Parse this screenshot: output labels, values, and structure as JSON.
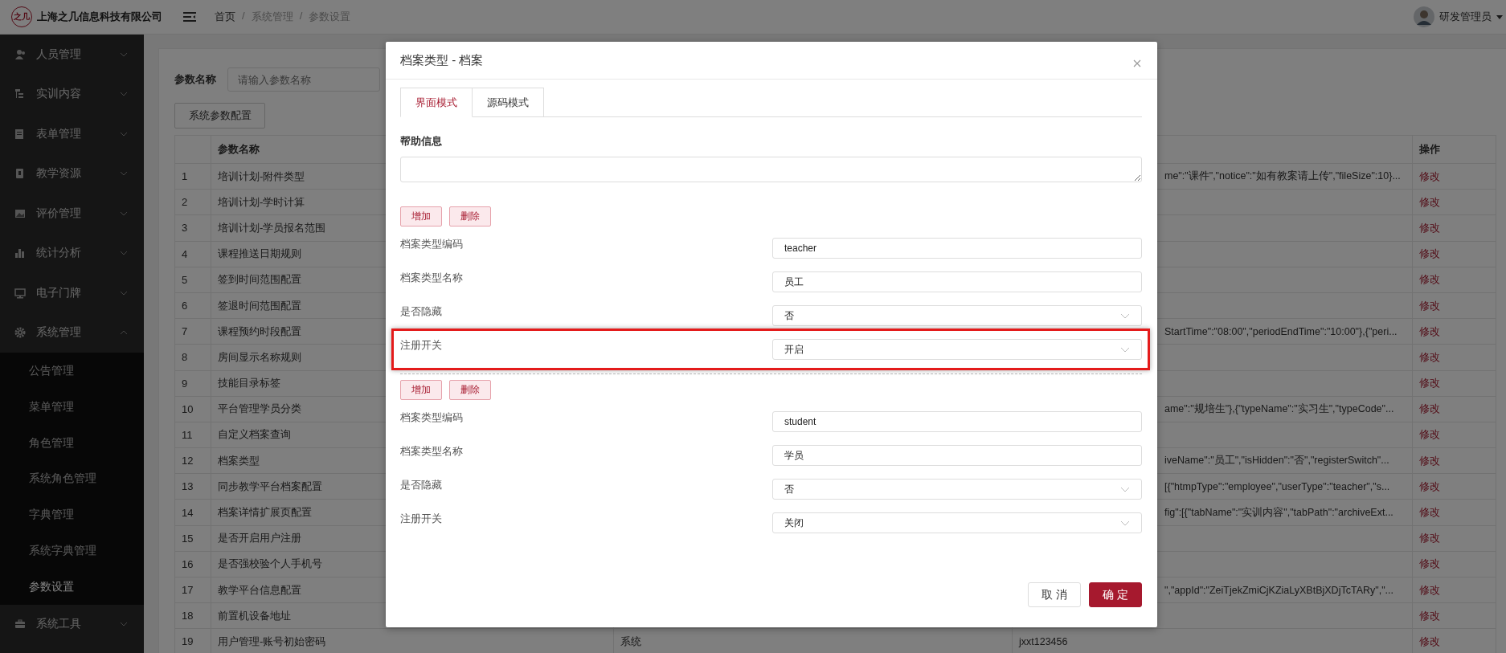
{
  "header": {
    "logo_text": "之几",
    "company": "上海之几信息科技有限公司",
    "breadcrumb": [
      "首页",
      "系统管理",
      "参数设置"
    ],
    "breadcrumb_separator": "/",
    "user": "研发管理员"
  },
  "sidebar": {
    "items": [
      {
        "label": "人员管理",
        "expanded": false
      },
      {
        "label": "实训内容",
        "expanded": false
      },
      {
        "label": "表单管理",
        "expanded": false
      },
      {
        "label": "教学资源",
        "expanded": false
      },
      {
        "label": "评价管理",
        "expanded": false
      },
      {
        "label": "统计分析",
        "expanded": false
      },
      {
        "label": "电子门牌",
        "expanded": false
      },
      {
        "label": "系统管理",
        "expanded": true,
        "children": [
          {
            "label": "公告管理",
            "selected": false
          },
          {
            "label": "菜单管理",
            "selected": false
          },
          {
            "label": "角色管理",
            "selected": false
          },
          {
            "label": "系统角色管理",
            "selected": false
          },
          {
            "label": "字典管理",
            "selected": false
          },
          {
            "label": "系统字典管理",
            "selected": false
          },
          {
            "label": "参数设置",
            "selected": true
          }
        ]
      },
      {
        "label": "系统工具",
        "expanded": false
      }
    ]
  },
  "search": {
    "label": "参数名称",
    "placeholder": "请输入参数名称"
  },
  "toolbar_button": "系统参数配置",
  "table": {
    "columns": {
      "name": "参数名称",
      "actions": "操作"
    },
    "rows": [
      {
        "index": "1",
        "name": "培训计划-附件类型",
        "column_4": "me\":\"课件\",\"notice\":\"如有教案请上传\",\"fileSize\":10}...",
        "action": "修改"
      },
      {
        "index": "2",
        "name": "培训计划-学时计算",
        "action": "修改"
      },
      {
        "index": "3",
        "name": "培训计划-学员报名范围",
        "action": "修改"
      },
      {
        "index": "4",
        "name": "课程推送日期规则",
        "action": "修改"
      },
      {
        "index": "5",
        "name": "签到时间范围配置",
        "action": "修改"
      },
      {
        "index": "6",
        "name": "签退时间范围配置",
        "action": "修改"
      },
      {
        "index": "7",
        "name": "课程预约时段配置",
        "column_4": "StartTime\":\"08:00\",\"periodEndTime\":\"10:00\"},{\"peri...",
        "action": "修改"
      },
      {
        "index": "8",
        "name": "房间显示名称规则",
        "action": "修改"
      },
      {
        "index": "9",
        "name": "技能目录标签",
        "action": "修改"
      },
      {
        "index": "10",
        "name": "平台管理学员分类",
        "column_4": "ame\":\"规培生\"},{\"typeName\":\"实习生\",\"typeCode\"...",
        "action": "修改"
      },
      {
        "index": "11",
        "name": "自定义档案查询",
        "action": "修改"
      },
      {
        "index": "12",
        "name": "档案类型",
        "column_4": "iveName\":\"员工\",\"isHidden\":\"否\",\"registerSwitch\"...",
        "action": "修改"
      },
      {
        "index": "13",
        "name": "同步教学平台档案配置",
        "column_4": "[{\"htmpType\":\"employee\",\"userType\":\"teacher\",\"s...",
        "action": "修改"
      },
      {
        "index": "14",
        "name": "档案详情扩展页配置",
        "column_4": "fig\":[{\"tabName\":\"实训内容\",\"tabPath\":\"archiveExt...",
        "action": "修改"
      },
      {
        "index": "15",
        "name": "是否开启用户注册",
        "action": "修改"
      },
      {
        "index": "16",
        "name": "是否强校验个人手机号",
        "action": "修改"
      },
      {
        "index": "17",
        "name": "教学平台信息配置",
        "column_4": "\",\"appId\":\"ZeiTjekZmiCjKZiaLyXBtBjXDjTcTARy\",\"...",
        "action": "修改"
      },
      {
        "index": "18",
        "name": "前置机设备地址",
        "action": "修改"
      },
      {
        "index": "19",
        "name": "用户管理-账号初始密码",
        "column_3": "系统",
        "column_4": "jxxt123456",
        "action": "修改"
      }
    ]
  },
  "modal": {
    "title": "档案类型 - 档案",
    "tabs": [
      {
        "label": "界面模式",
        "selected": true
      },
      {
        "label": "源码模式",
        "selected": false
      }
    ],
    "help_label": "帮助信息",
    "groups": [
      {
        "add": "增加",
        "delete": "删除",
        "fields": [
          {
            "label": "档案类型编码",
            "value": "teacher",
            "kind": "text",
            "highlighted": false
          },
          {
            "label": "档案类型名称",
            "value": "员工",
            "kind": "text",
            "highlighted": false
          },
          {
            "label": "是否隐藏",
            "value": "否",
            "kind": "select",
            "highlighted": false
          },
          {
            "label": "注册开关",
            "value": "开启",
            "kind": "select",
            "highlighted": true
          }
        ]
      },
      {
        "add": "增加",
        "delete": "删除",
        "fields": [
          {
            "label": "档案类型编码",
            "value": "student",
            "kind": "text",
            "highlighted": false
          },
          {
            "label": "档案类型名称",
            "value": "学员",
            "kind": "text",
            "highlighted": false
          },
          {
            "label": "是否隐藏",
            "value": "否",
            "kind": "select",
            "highlighted": false
          },
          {
            "label": "注册开关",
            "value": "关闭",
            "kind": "select",
            "highlighted": false
          }
        ]
      }
    ],
    "buttons": [
      {
        "label": "取 消",
        "kind": "secondary"
      },
      {
        "label": "确 定",
        "kind": "primary"
      }
    ]
  }
}
